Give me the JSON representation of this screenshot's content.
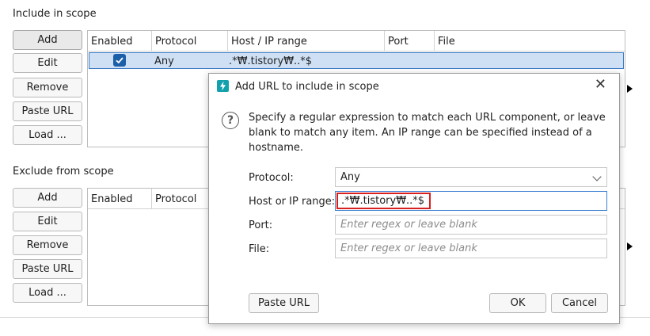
{
  "include": {
    "title": "Include in scope",
    "buttons": {
      "add": "Add",
      "edit": "Edit",
      "remove": "Remove",
      "paste_url": "Paste URL",
      "load": "Load ..."
    },
    "columns": [
      "Enabled",
      "Protocol",
      "Host / IP range",
      "Port",
      "File"
    ],
    "rows": [
      {
        "enabled": true,
        "protocol": "Any",
        "host": ".*₩.tistory₩..*$",
        "port": "",
        "file": ""
      }
    ]
  },
  "exclude": {
    "title": "Exclude from scope",
    "buttons": {
      "add": "Add",
      "edit": "Edit",
      "remove": "Remove",
      "paste_url": "Paste URL",
      "load": "Load ..."
    },
    "columns": [
      "Enabled",
      "Protocol"
    ]
  },
  "dialog": {
    "title": "Add URL to include in scope",
    "close": "✕",
    "help": "?",
    "description": "Specify a regular expression to match each URL component, or leave blank to match any item. An IP range can be specified instead of a hostname.",
    "fields": {
      "protocol_label": "Protocol:",
      "protocol_value": "Any",
      "host_label": "Host or IP range:",
      "host_value": ".*₩.tistory₩..*$",
      "port_label": "Port:",
      "port_placeholder": "Enter regex or leave blank",
      "file_label": "File:",
      "file_placeholder": "Enter regex or leave blank"
    },
    "buttons": {
      "paste_url": "Paste URL",
      "ok": "OK",
      "cancel": "Cancel"
    }
  },
  "colors": {
    "accent": "#1c5fa9",
    "selection": "#cfe0f5",
    "highlight_border": "#d72020",
    "icon_teal": "#11a1ad"
  },
  "icons": {
    "dialog_icon": "lightning-icon",
    "help_icon": "question-icon",
    "close_icon": "close-icon",
    "checkbox": "check-icon"
  }
}
